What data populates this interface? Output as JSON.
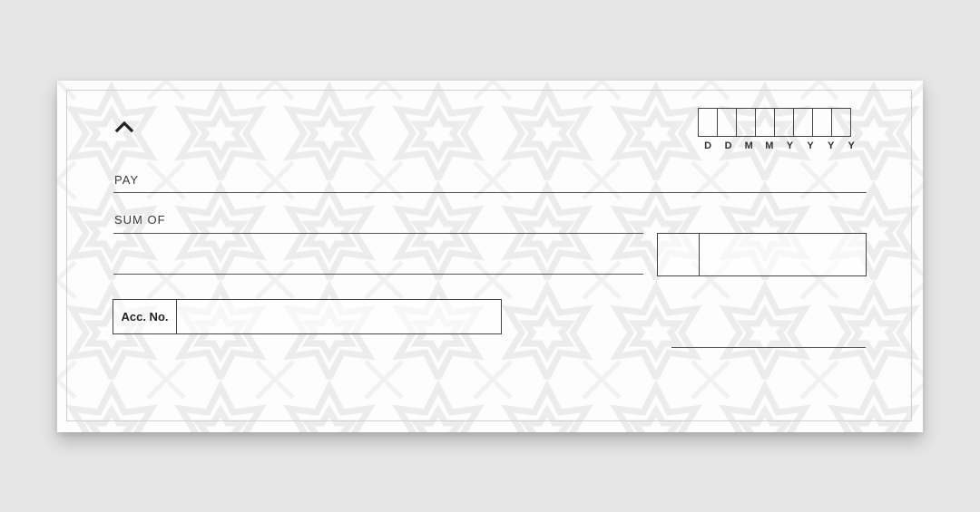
{
  "cheque": {
    "date_labels": [
      "D",
      "D",
      "M",
      "M",
      "Y",
      "Y",
      "Y",
      "Y"
    ],
    "pay_label": "PAY",
    "sum_label": "SUM OF",
    "acc_label": "Acc. No."
  },
  "icons": {
    "logo": "chevron-up-icon"
  },
  "colors": {
    "background": "#e6e6e6",
    "paper": "#fdfdfd",
    "ink": "#444444"
  }
}
